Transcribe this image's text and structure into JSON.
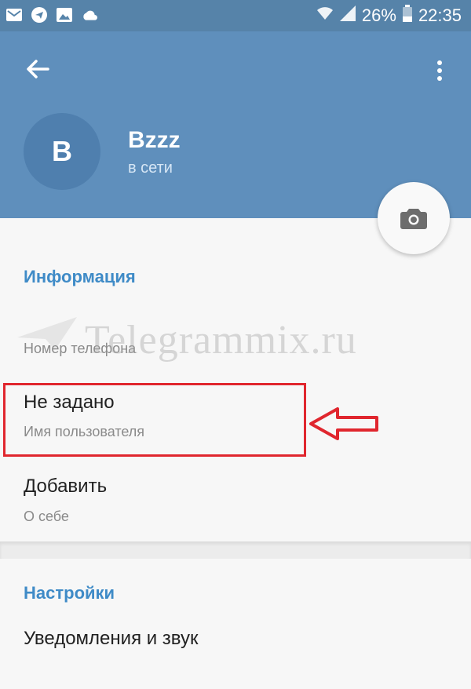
{
  "status_bar": {
    "battery": "26%",
    "time": "22:35",
    "icons": [
      "gmail-icon",
      "telegram-icon",
      "image-icon",
      "cloud-icon",
      "wifi-icon",
      "signal-icon",
      "battery-icon"
    ]
  },
  "header": {
    "back_icon": "arrow-left-icon",
    "more_icon": "more-vert-icon",
    "avatar_letter": "B",
    "name": "Bzzz",
    "status": "в сети",
    "camera_icon": "camera-icon"
  },
  "info": {
    "title": "Информация",
    "phone": {
      "label": "Номер телефона"
    },
    "username": {
      "value": "Не задано",
      "label": "Имя пользователя"
    },
    "about": {
      "value": "Добавить",
      "label": "О себе"
    }
  },
  "settings": {
    "title": "Настройки",
    "notifications": "Уведомления и звук"
  },
  "watermark": "Telegrammix.ru",
  "colors": {
    "header": "#5f8fbc",
    "statusbar": "#5683a9",
    "accent": "#3f8bc7",
    "highlight": "#e0262e"
  }
}
